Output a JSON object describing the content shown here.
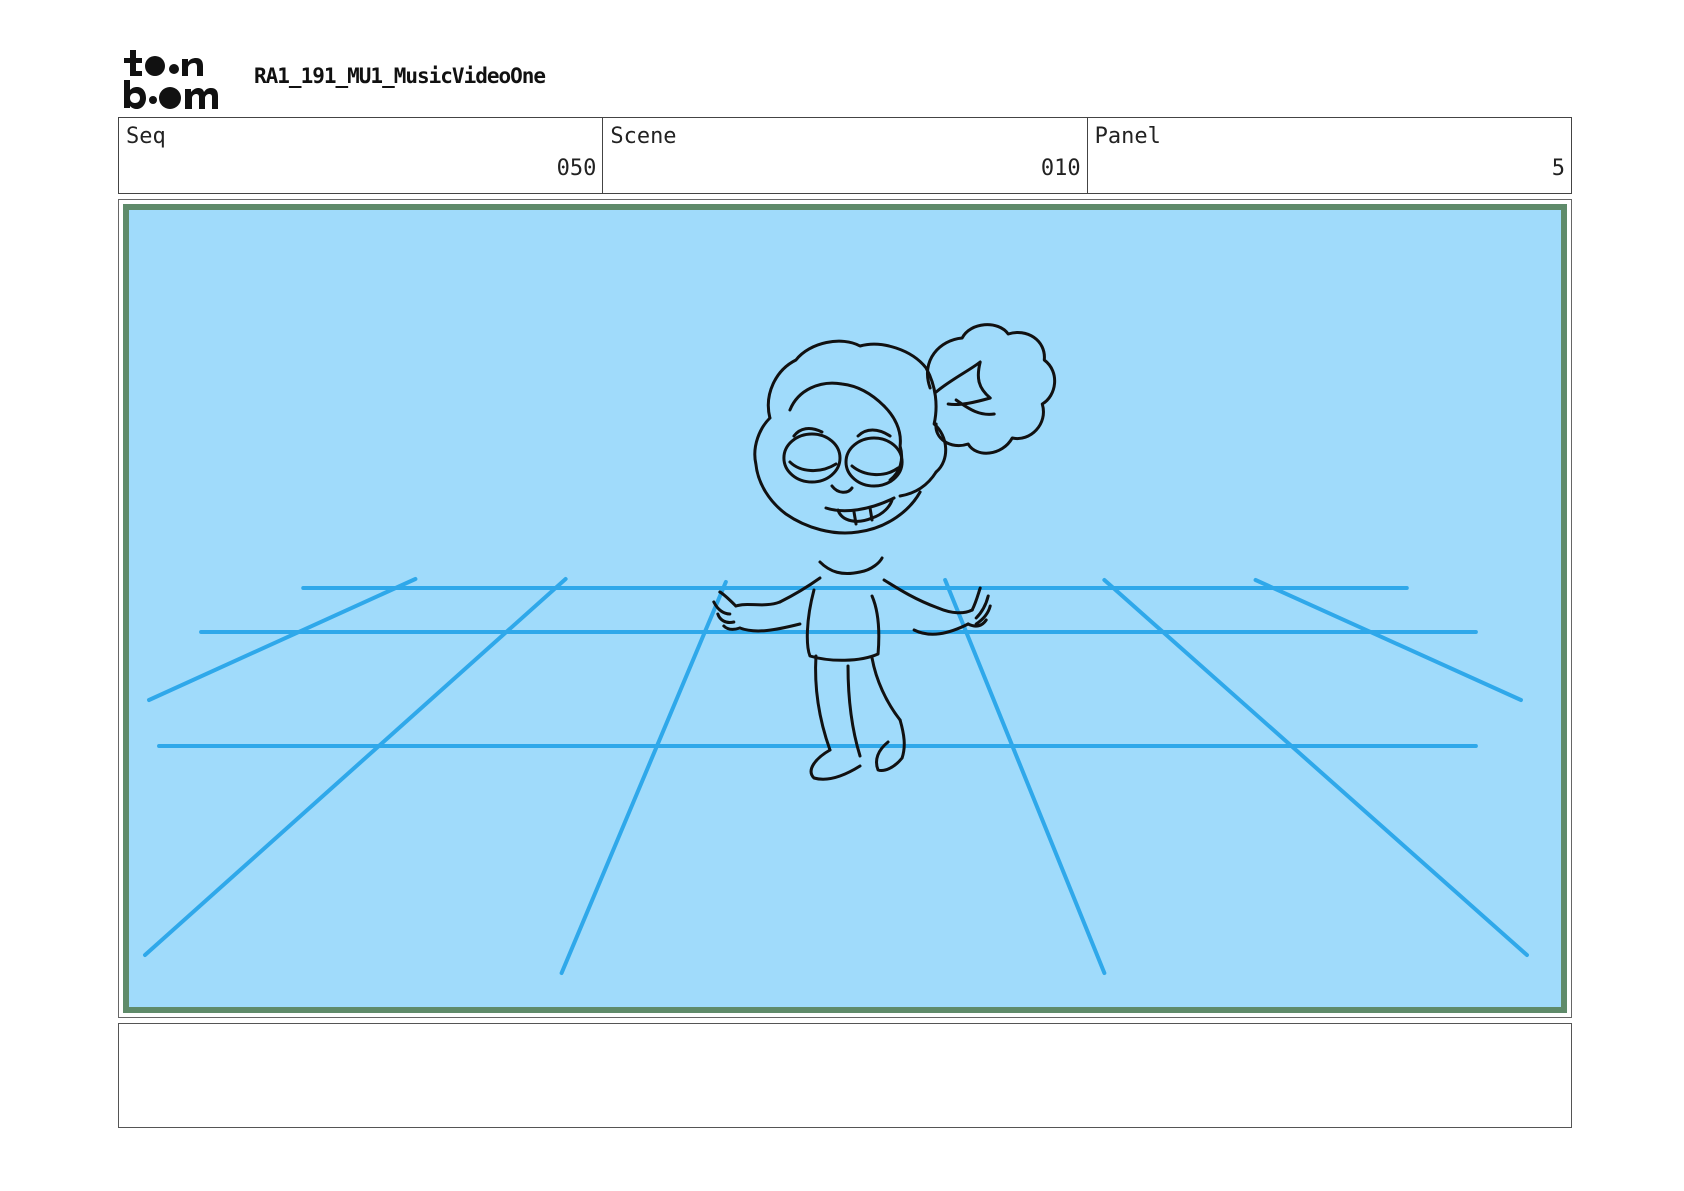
{
  "header": {
    "logo": {
      "line1": "toon",
      "line2": "boom",
      "icon": "toon-boom-logo"
    },
    "project_title": "RA1_191_MU1_MusicVideoOne"
  },
  "info": {
    "seq_label": "Seq",
    "seq_value": "050",
    "scene_label": "Scene",
    "scene_value": "010",
    "panel_label": "Panel",
    "panel_value": "5"
  },
  "panel": {
    "description": "",
    "colors": {
      "background": "#a0dbfb",
      "grid": "#2fa8ea",
      "border": "#5f8b6a",
      "ink": "#111111"
    }
  },
  "notes": {
    "text": ""
  }
}
